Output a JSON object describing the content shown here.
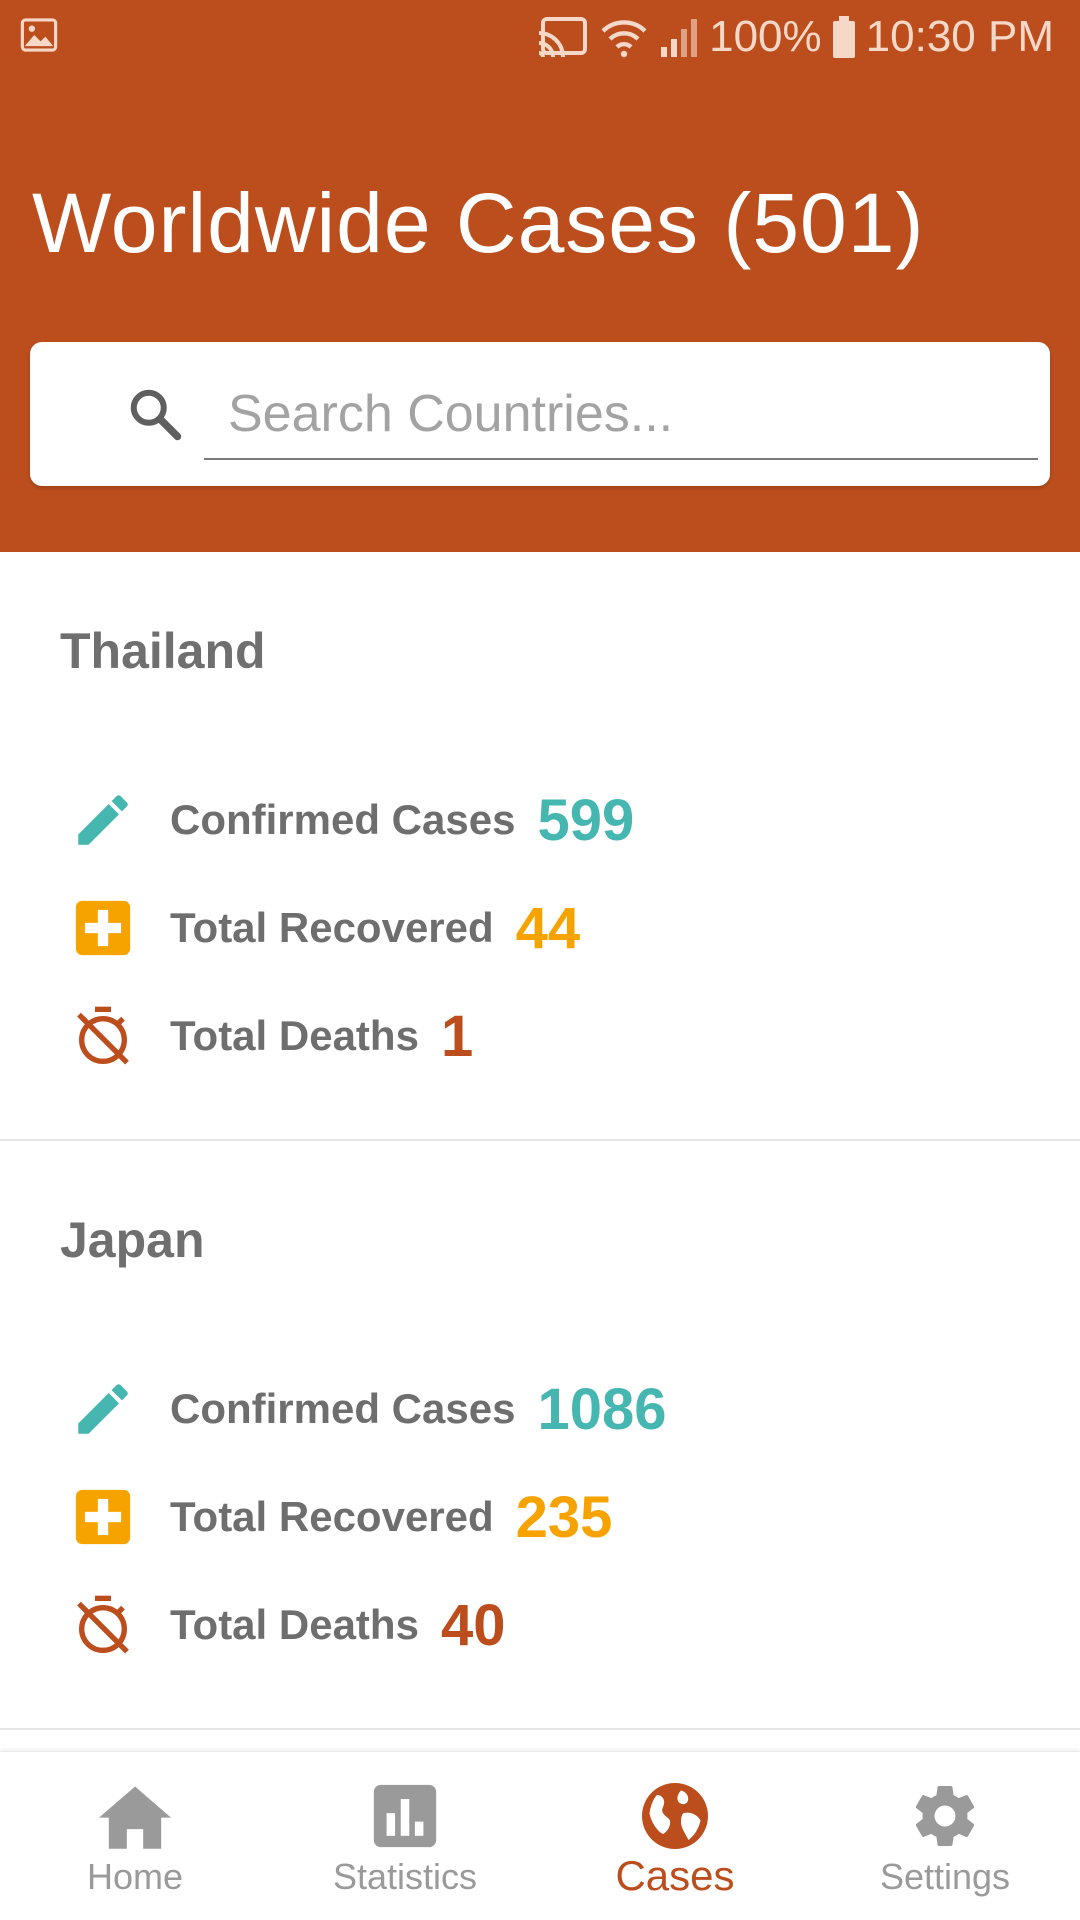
{
  "status_bar": {
    "battery": "100%",
    "time": "10:30 PM"
  },
  "header": {
    "title": "Worldwide Cases (501)"
  },
  "search": {
    "placeholder": "Search Countries..."
  },
  "labels": {
    "confirmed": "Confirmed Cases",
    "recovered": "Total Recovered",
    "deaths": "Total Deaths"
  },
  "countries": [
    {
      "name": "Thailand",
      "confirmed": "599",
      "recovered": "44",
      "deaths": "1"
    },
    {
      "name": "Japan",
      "confirmed": "1086",
      "recovered": "235",
      "deaths": "40"
    }
  ],
  "nav": [
    {
      "label": "Home",
      "icon": "home-icon"
    },
    {
      "label": "Statistics",
      "icon": "bar-chart-icon"
    },
    {
      "label": "Cases",
      "icon": "globe-icon",
      "active": true
    },
    {
      "label": "Settings",
      "icon": "gear-icon"
    }
  ],
  "colors": {
    "header": "#bc4e1e",
    "confirmed": "#45b6b0",
    "recovered": "#f6a300",
    "deaths": "#bc4e1e",
    "nav_inactive": "#9a9a9a"
  }
}
